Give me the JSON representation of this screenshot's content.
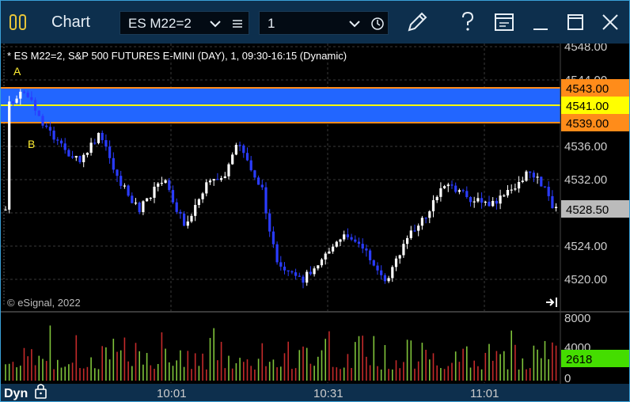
{
  "window": {
    "title": "Chart",
    "symbol_value": "ES M22=2",
    "interval_value": "1",
    "icons": [
      "chart-app-icon",
      "chevron-down-icon",
      "list-icon",
      "chevron-down-icon",
      "clock-icon",
      "pencil-icon",
      "help-icon",
      "save-icon",
      "minimize-icon",
      "maximize-icon",
      "close-icon"
    ]
  },
  "chart": {
    "header": "* ES M22=2, S&P 500 FUTURES E-MINI (DAY), 1, 09:30-16:15 (Dynamic)",
    "copyright": "© eSignal, 2022",
    "label_a": "A",
    "label_b": "B",
    "price_axis": [
      "4548.00",
      "4544.00",
      "4536.00",
      "4532.00",
      "4524.00",
      "4520.00"
    ],
    "volume_axis": [
      "8000",
      "4000",
      "0"
    ],
    "time_axis": [
      "10:01",
      "10:31",
      "11:01"
    ],
    "dyn_label": "Dyn",
    "last_price": "4528.50",
    "last_volume": "2618",
    "fib_levels": [
      {
        "value": "4543.00",
        "color": "#ff8c1a"
      },
      {
        "value": "4541.00",
        "color": "#ffff00"
      },
      {
        "value": "4539.00",
        "color": "#ff8c1a"
      }
    ],
    "colors": {
      "up": "#ffffff",
      "down": "#2a3cff",
      "band": "#2266ff",
      "vol_up": "#7fc33a",
      "vol_down": "#c42a2a",
      "last_volume_bg": "#44dd00",
      "last_price_bg": "#bbbbbb"
    }
  }
}
